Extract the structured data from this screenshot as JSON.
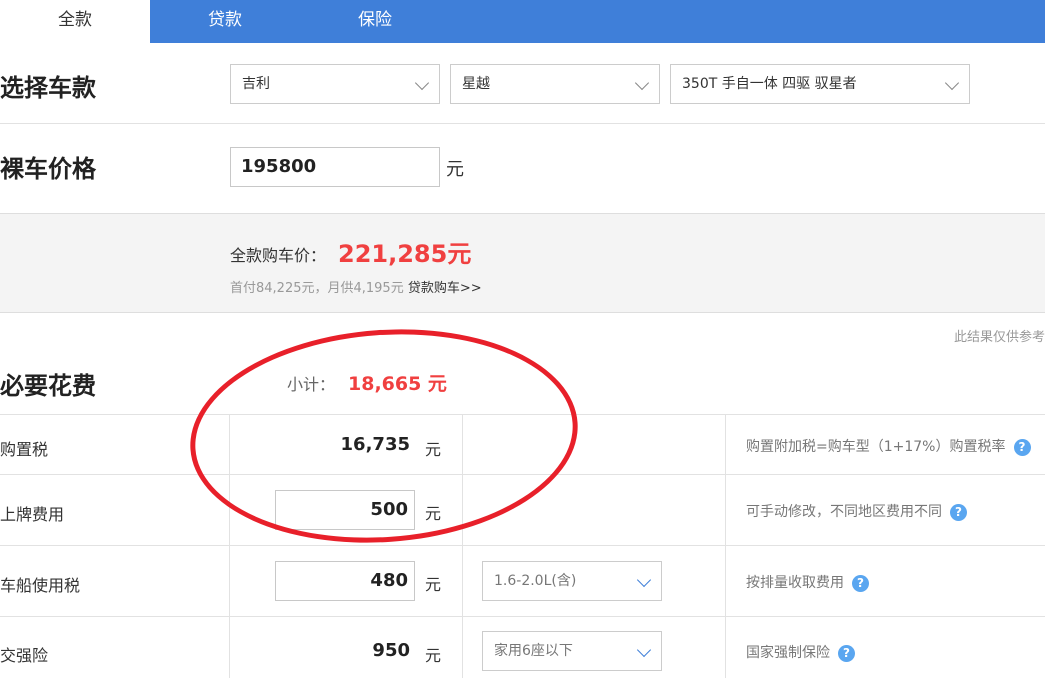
{
  "tabs": [
    {
      "label": "全款",
      "active": true
    },
    {
      "label": "贷款",
      "active": false
    },
    {
      "label": "保险",
      "active": false
    }
  ],
  "select_model": {
    "label": "选择车款",
    "brand": "吉利",
    "series": "星越",
    "trim": "350T 手自一体 四驱 驭星者"
  },
  "base_price": {
    "label": "裸车价格",
    "value": "195800",
    "unit": "元"
  },
  "summary": {
    "total_label": "全款购车价：",
    "total_value": "221,285元",
    "loan_info": "首付84,225元，月供4,195元",
    "loan_link": "贷款购车>>"
  },
  "note": "此结果仅供参考",
  "required": {
    "label": "必要花费",
    "subtotal_label": "小计：",
    "subtotal_value": "18,665 元",
    "rows": [
      {
        "label": "购置税",
        "value": "16,735",
        "unit": "元",
        "option": "",
        "desc": "购置附加税=购车型（1+17%）购置税率"
      },
      {
        "label": "上牌费用",
        "value": "500",
        "unit": "元",
        "option": "",
        "desc": "可手动修改，不同地区费用不同"
      },
      {
        "label": "车船使用税",
        "value": "480",
        "unit": "元",
        "option": "1.6-2.0L(含)",
        "desc": "按排量收取费用"
      },
      {
        "label": "交强险",
        "value": "950",
        "unit": "元",
        "option": "家用6座以下",
        "desc": "国家强制保险"
      }
    ]
  },
  "help_icon_glyph": "?",
  "colors": {
    "accent": "#3f7fd9",
    "price": "#f04040",
    "annotation": "#e8202a"
  }
}
